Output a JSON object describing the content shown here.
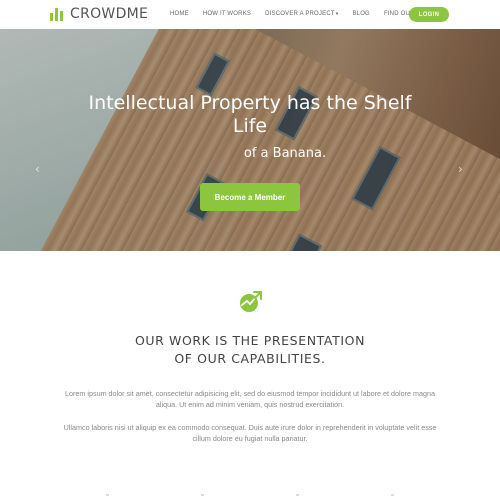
{
  "brand": {
    "name": "CROWDME",
    "accent": "#8cc63f"
  },
  "nav": {
    "items": [
      {
        "label": "HOME"
      },
      {
        "label": "HOW IT WORKS"
      },
      {
        "label": "DISCOVER A PROJECT",
        "has_dropdown": true
      },
      {
        "label": "BLOG"
      },
      {
        "label": "FIND OUT MORE"
      }
    ],
    "login_label": "LOGIN"
  },
  "hero": {
    "title": "Intellectual Property has the Shelf Life",
    "subtitle": "of a Banana.",
    "cta_label": "Become a Member",
    "prev_icon": "chevron-left-icon",
    "next_icon": "chevron-right-icon"
  },
  "section": {
    "icon": "chart-arrow-icon",
    "heading_line1": "OUR WORK IS THE PRESENTATION",
    "heading_line2": "OF OUR CAPABILITIES.",
    "paragraph1": "Lorem ipsum dolor sit amet, consectetur adipisicing elit, sed do eiusmod tempor incididunt ut labore et dolore magna aliqua. Ut enim ad minim veniam, quis nostrud exercitation.",
    "paragraph2": "Ullamco laboris nisi ut aliquip ex ea commodo consequat. Duis aute irure dolor in reprehenderit in voluptate velit esse cillum dolore eu fugiat nulla pariatur."
  }
}
